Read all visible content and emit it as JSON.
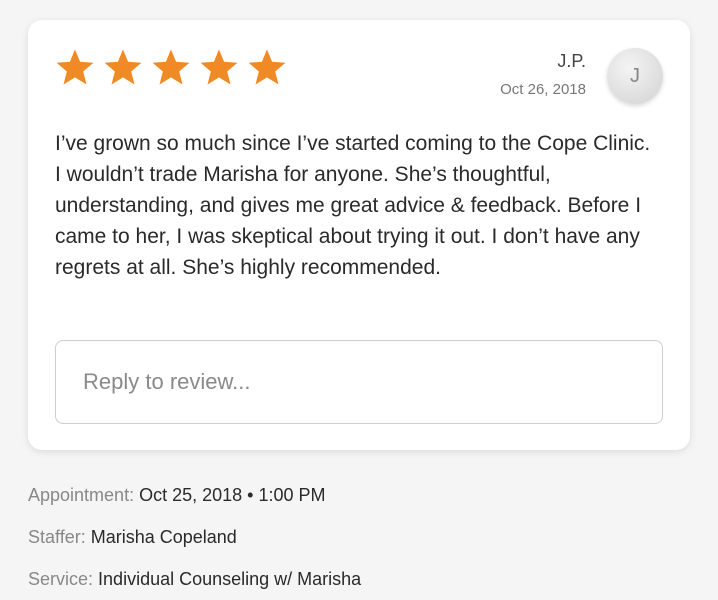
{
  "review": {
    "rating": 5,
    "max_rating": 5,
    "star_color": "#f08a24",
    "reviewer_name": "J.P.",
    "date": "Oct 26, 2018",
    "avatar_initial": "J",
    "text": "I’ve grown so much since I’ve started coming to the Cope Clinic. I wouldn’t trade Marisha for anyone. She’s thoughtful, understanding, and gives me great advice & feedback. Before I came to her, I was skeptical about trying it out. I don’t have any regrets at all. She’s highly recommended.",
    "reply_placeholder": "Reply to review..."
  },
  "details": {
    "appointment_label": "Appointment:",
    "appointment_value": "Oct 25, 2018 • 1:00 PM",
    "staffer_label": "Staffer:",
    "staffer_value": "Marisha Copeland",
    "service_label": "Service:",
    "service_value": "Individual Counseling w/ Marisha"
  }
}
